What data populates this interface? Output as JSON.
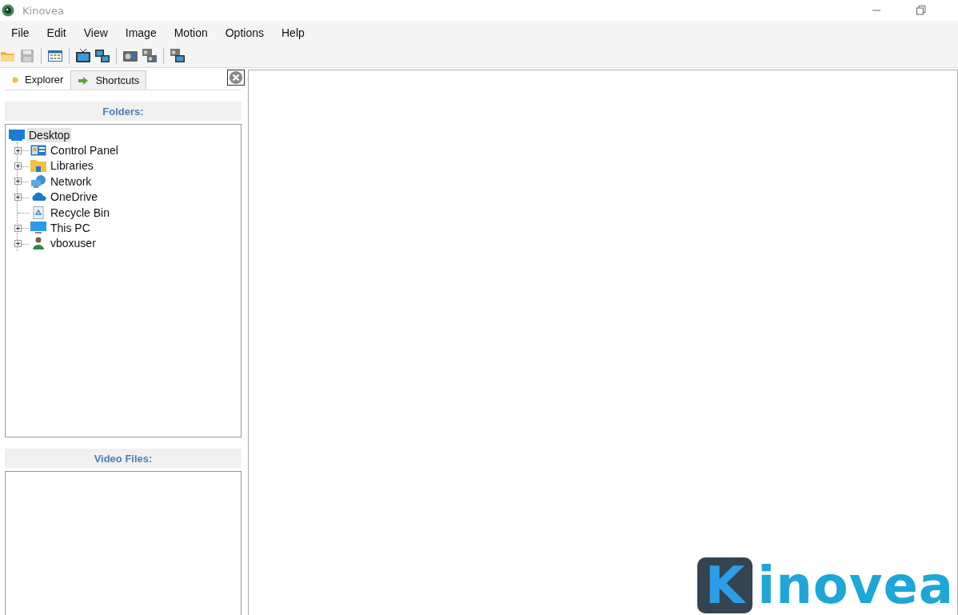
{
  "window": {
    "title": "Kinovea"
  },
  "menu": [
    "File",
    "Edit",
    "View",
    "Image",
    "Motion",
    "Options",
    "Help"
  ],
  "toolbar": [
    {
      "kind": "folder"
    },
    {
      "kind": "save",
      "disabled": true
    },
    {
      "kind": "sep"
    },
    {
      "kind": "grid"
    },
    {
      "kind": "sep"
    },
    {
      "kind": "tv"
    },
    {
      "kind": "tv2"
    },
    {
      "kind": "sep"
    },
    {
      "kind": "camera"
    },
    {
      "kind": "camera2"
    },
    {
      "kind": "sep"
    },
    {
      "kind": "camtv"
    }
  ],
  "tabs": [
    {
      "label": "Explorer",
      "kind": "dot",
      "selected": true
    },
    {
      "label": "Shortcuts",
      "kind": "arrow",
      "selected": false
    }
  ],
  "folders": {
    "title": "Folders:",
    "tree": [
      {
        "label": "Desktop",
        "kind": "monitor",
        "selected": true,
        "children": [
          {
            "label": "Control Panel",
            "kind": "panel",
            "selected": false,
            "expanded": false
          },
          {
            "label": "Libraries",
            "kind": "folder",
            "selected": false,
            "expanded": false
          },
          {
            "label": "Network",
            "kind": "network",
            "selected": false,
            "expanded": false
          },
          {
            "label": "OneDrive",
            "kind": "cloud",
            "selected": false,
            "expanded": false
          },
          {
            "label": "Recycle Bin",
            "kind": "bin",
            "selected": false
          },
          {
            "label": "This PC",
            "kind": "monitor",
            "selected": false,
            "expanded": false
          },
          {
            "label": "vboxuser",
            "kind": "user",
            "selected": false,
            "expanded": false
          }
        ]
      }
    ]
  },
  "video_files": {
    "title": "Video Files:"
  },
  "logo": {
    "initial": "K",
    "rest": "inovea"
  }
}
